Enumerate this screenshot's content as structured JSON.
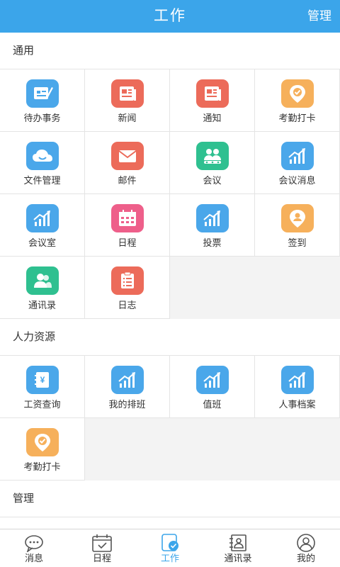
{
  "header": {
    "title": "工作",
    "action": "管理"
  },
  "sections": [
    {
      "title": "通用",
      "items": [
        {
          "label": "待办事务",
          "icon": "todo-icon",
          "color": "#4aa7ea"
        },
        {
          "label": "新闻",
          "icon": "news-icon",
          "color": "#ec6b5a"
        },
        {
          "label": "通知",
          "icon": "notice-icon",
          "color": "#ec6b5a"
        },
        {
          "label": "考勤打卡",
          "icon": "location-check-icon",
          "color": "#f6b05b"
        },
        {
          "label": "文件管理",
          "icon": "cloud-icon",
          "color": "#4aa7ea"
        },
        {
          "label": "邮件",
          "icon": "mail-icon",
          "color": "#ec6b5a"
        },
        {
          "label": "会议",
          "icon": "people-icon",
          "color": "#2fc090"
        },
        {
          "label": "会议消息",
          "icon": "chart-icon",
          "color": "#4aa7ea"
        },
        {
          "label": "会议室",
          "icon": "chart-icon",
          "color": "#4aa7ea"
        },
        {
          "label": "日程",
          "icon": "calendar-icon",
          "color": "#ee5f8a"
        },
        {
          "label": "投票",
          "icon": "chart-icon",
          "color": "#4aa7ea"
        },
        {
          "label": "签到",
          "icon": "location-icon",
          "color": "#f6b05b"
        },
        {
          "label": "通讯录",
          "icon": "contacts-icon",
          "color": "#2fc090"
        },
        {
          "label": "日志",
          "icon": "clipboard-icon",
          "color": "#ec6b5a"
        }
      ]
    },
    {
      "title": "人力资源",
      "items": [
        {
          "label": "工资查询",
          "icon": "salary-icon",
          "color": "#4aa7ea"
        },
        {
          "label": "我的排班",
          "icon": "chart-icon",
          "color": "#4aa7ea"
        },
        {
          "label": "值班",
          "icon": "chart-icon",
          "color": "#4aa7ea"
        },
        {
          "label": "人事档案",
          "icon": "chart-icon",
          "color": "#4aa7ea"
        },
        {
          "label": "考勤打卡",
          "icon": "location-check-icon",
          "color": "#f6b05b"
        }
      ]
    },
    {
      "title": "管理",
      "items": []
    }
  ],
  "tabbar": [
    {
      "label": "消息",
      "icon": "chat-icon",
      "active": false
    },
    {
      "label": "日程",
      "icon": "calendar-check-icon",
      "active": false
    },
    {
      "label": "工作",
      "icon": "work-icon",
      "active": true
    },
    {
      "label": "通讯录",
      "icon": "address-book-icon",
      "active": false
    },
    {
      "label": "我的",
      "icon": "user-icon",
      "active": false
    }
  ]
}
